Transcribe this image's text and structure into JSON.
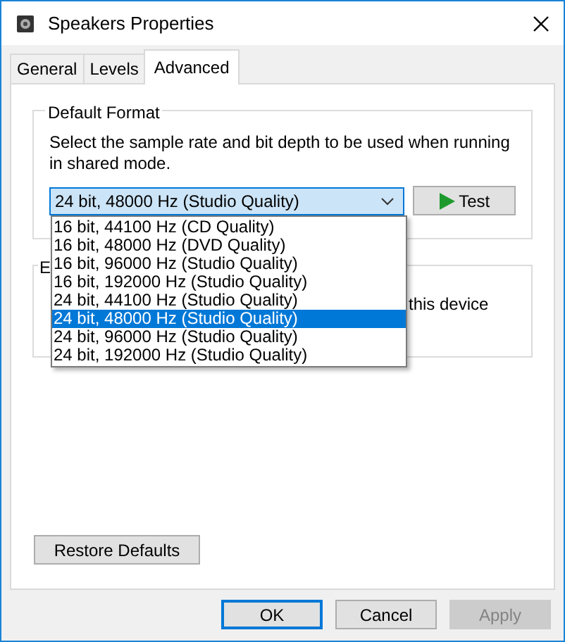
{
  "window": {
    "title": "Speakers Properties"
  },
  "tabs": [
    {
      "label": "General",
      "selected": false
    },
    {
      "label": "Levels",
      "selected": false
    },
    {
      "label": "Advanced",
      "selected": true
    }
  ],
  "default_format": {
    "title": "Default Format",
    "description": "Select the sample rate and bit depth to be used when running in shared mode.",
    "combo": {
      "value": "24 bit, 48000 Hz (Studio Quality)",
      "expanded": true
    },
    "test_button": "Test",
    "options": [
      {
        "label": "16 bit, 44100 Hz (CD Quality)",
        "selected": false
      },
      {
        "label": "16 bit, 48000 Hz (DVD Quality)",
        "selected": false
      },
      {
        "label": "16 bit, 96000 Hz (Studio Quality)",
        "selected": false
      },
      {
        "label": "16 bit, 192000 Hz (Studio Quality)",
        "selected": false
      },
      {
        "label": "24 bit, 44100 Hz (Studio Quality)",
        "selected": false
      },
      {
        "label": "24 bit, 48000 Hz (Studio Quality)",
        "selected": true
      },
      {
        "label": "24 bit, 96000 Hz (Studio Quality)",
        "selected": false
      },
      {
        "label": "24 bit, 192000 Hz (Studio Quality)",
        "selected": false
      }
    ]
  },
  "exclusive_group": {
    "title": "E",
    "text": "this device"
  },
  "restore_button": "Restore Defaults",
  "buttons": [
    {
      "label": "OK",
      "default": true,
      "disabled": false
    },
    {
      "label": "Cancel",
      "default": false,
      "disabled": false
    },
    {
      "label": "Apply",
      "default": false,
      "disabled": true
    }
  ]
}
